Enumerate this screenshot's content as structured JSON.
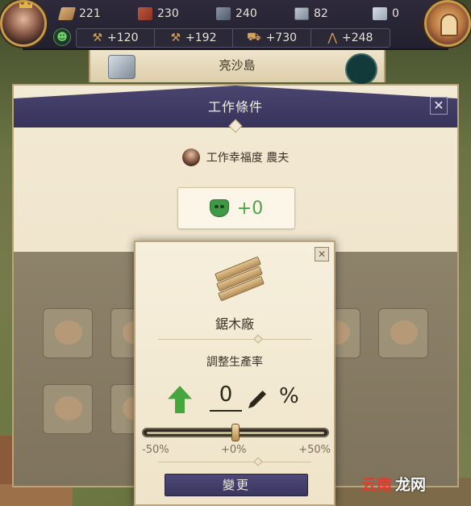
{
  "resources": [
    {
      "icon": "wood-plank-icon",
      "value": "221"
    },
    {
      "icon": "brick-icon",
      "value": "230"
    },
    {
      "icon": "steel-beam-icon",
      "value": "240"
    },
    {
      "icon": "window-icon",
      "value": "82"
    },
    {
      "icon": "glass-icon",
      "value": "0"
    }
  ],
  "income": [
    {
      "icon": "hammer-icon",
      "value": "+120"
    },
    {
      "icon": "hammer-icon",
      "value": "+192"
    },
    {
      "icon": "cart-icon",
      "value": "+730"
    },
    {
      "icon": "compass-icon",
      "value": "+248"
    }
  ],
  "island": {
    "name": "亮沙島"
  },
  "dialog": {
    "title": "工作條件",
    "close": "✕",
    "happiness_label": "工作幸福度 農夫",
    "happiness_value": "+0"
  },
  "popup": {
    "close": "✕",
    "building": "鋸木廠",
    "rate_label": "調整生產率",
    "rate_value": "0",
    "percent_sign": "%",
    "slider": {
      "min_label": "-50%",
      "mid_label": "+0%",
      "max_label": "+50%",
      "value": 0,
      "min": -50,
      "max": 50
    },
    "change_button": "變更"
  },
  "watermark": {
    "part1": "云南",
    "part2": "龙网"
  },
  "colors": {
    "accent_purple": "#3a365e",
    "happiness_green": "#4ea547",
    "parchment": "#f3ead5"
  }
}
